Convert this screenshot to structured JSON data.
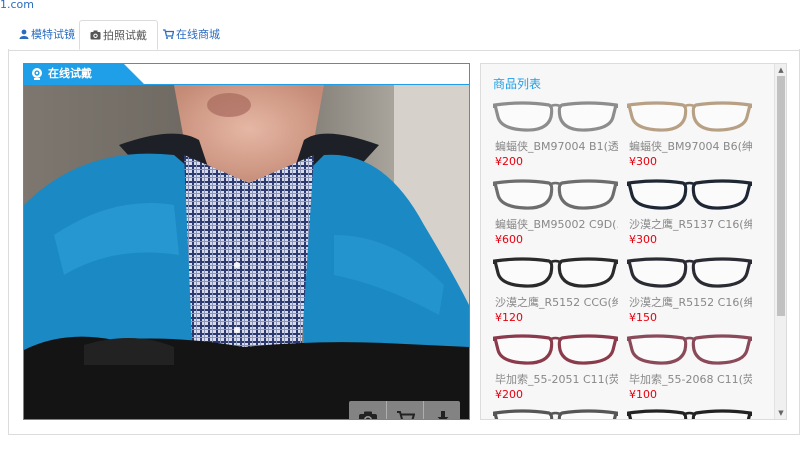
{
  "top_link": "1.com",
  "tabs": [
    {
      "label": "模特试镜",
      "icon": "user-icon",
      "active": false
    },
    {
      "label": "拍照试戴",
      "icon": "camera-icon",
      "active": true
    },
    {
      "label": "在线商城",
      "icon": "cart-icon",
      "active": false
    }
  ],
  "tryon": {
    "title": "在线试戴",
    "icon": "webcam-icon"
  },
  "toolbar": {
    "buttons": [
      {
        "icon": "camera-icon"
      },
      {
        "icon": "cart-icon"
      },
      {
        "icon": "download-icon"
      }
    ]
  },
  "products": {
    "title": "商品列表",
    "items": [
      {
        "name": "蝙蝠侠_BM97004 B1(透...",
        "price": "¥200",
        "frame_color": "#8d8d8d"
      },
      {
        "name": "蝙蝠侠_BM97004 B6(绅...",
        "price": "¥300",
        "frame_color": "#b7a084"
      },
      {
        "name": "蝙蝠侠_BM95002 C9D(...",
        "price": "¥600",
        "frame_color": "#6d6d6d"
      },
      {
        "name": "沙漠之鹰_R5137 C16(绅...",
        "price": "¥300",
        "frame_color": "#1f2735"
      },
      {
        "name": "沙漠之鹰_R5152 CCG(绅...",
        "price": "¥120",
        "frame_color": "#2a2a2a"
      },
      {
        "name": "沙漠之鹰_R5152 C16(绅...",
        "price": "¥150",
        "frame_color": "#2b2b33"
      },
      {
        "name": "毕加索_55-2051 C11(荧...",
        "price": "¥200",
        "frame_color": "#8a3a4a"
      },
      {
        "name": "毕加索_55-2068 C11(荧...",
        "price": "¥100",
        "frame_color": "#8a4a5a"
      },
      {
        "name": "",
        "price": "",
        "frame_color": "#555555"
      },
      {
        "name": "",
        "price": "",
        "frame_color": "#222222"
      }
    ]
  },
  "colors": {
    "accent": "#1e9fe8",
    "price": "#e8000f",
    "link": "#2a6cc0"
  }
}
